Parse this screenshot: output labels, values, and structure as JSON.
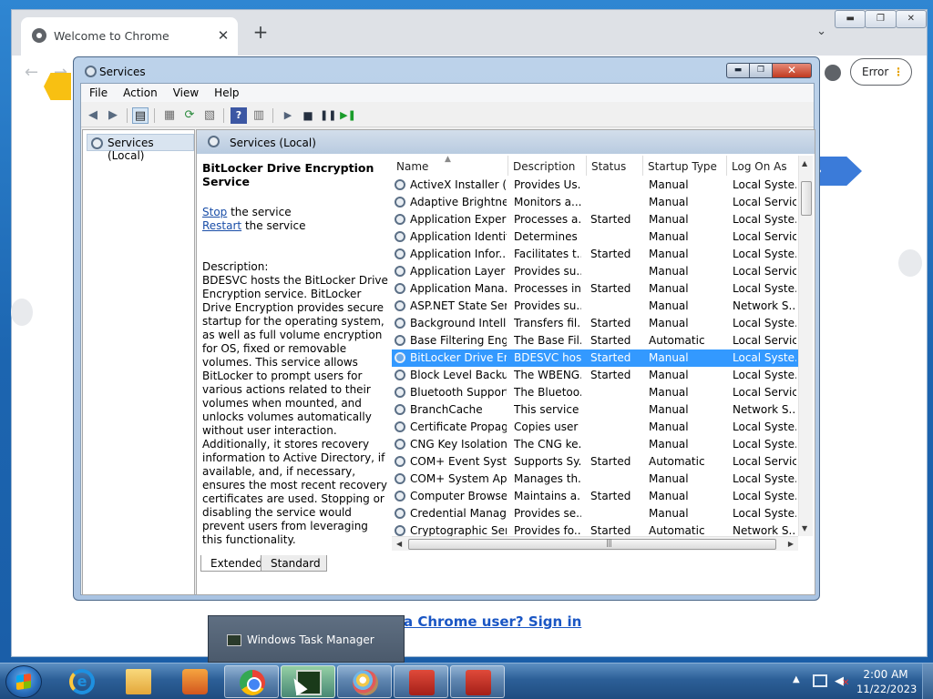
{
  "chrome": {
    "tab_title": "Welcome to Chrome",
    "tab_close": "✕",
    "new_tab": "+",
    "tab_dropdown": "⌄",
    "back": "←",
    "forward": "→",
    "error_label": "Error",
    "error_menu": "⋮",
    "signin_text": "y a Chrome user? Sign in",
    "window_controls": [
      "▬",
      "❐",
      "✕"
    ]
  },
  "services": {
    "window_title": "Services",
    "window_controls": [
      "▬",
      "❐",
      "✕"
    ],
    "menu": [
      "File",
      "Action",
      "View",
      "Help"
    ],
    "tree_item": "Services (Local)",
    "pane_title": "Services (Local)",
    "selected_service": "BitLocker Drive Encryption Service",
    "stop_link": "Stop",
    "stop_suffix": " the service",
    "restart_link": "Restart",
    "restart_suffix": " the service",
    "description_label": "Description:",
    "description": "BDESVC hosts the BitLocker Drive Encryption service. BitLocker Drive Encryption provides secure startup for the operating system, as well as full volume encryption for OS, fixed or removable volumes. This service allows BitLocker to prompt users for various actions related to their volumes when mounted, and unlocks volumes automatically without user interaction. Additionally, it stores recovery information to Active Directory, if available, and, if necessary, ensures the most recent recovery certificates are used. Stopping or disabling the service would prevent users from leveraging this functionality.",
    "columns": [
      "Name",
      "Description",
      "Status",
      "Startup Type",
      "Log On As"
    ],
    "rows": [
      {
        "name": "ActiveX Installer (...",
        "desc": "Provides Us...",
        "status": "",
        "startup": "Manual",
        "logon": "Local Syste..."
      },
      {
        "name": "Adaptive Brightness",
        "desc": "Monitors a...",
        "status": "",
        "startup": "Manual",
        "logon": "Local Service"
      },
      {
        "name": "Application Experi...",
        "desc": "Processes a...",
        "status": "Started",
        "startup": "Manual",
        "logon": "Local Syste..."
      },
      {
        "name": "Application Identity",
        "desc": "Determines ...",
        "status": "",
        "startup": "Manual",
        "logon": "Local Service"
      },
      {
        "name": "Application Infor...",
        "desc": "Facilitates t...",
        "status": "Started",
        "startup": "Manual",
        "logon": "Local Syste..."
      },
      {
        "name": "Application Layer ...",
        "desc": "Provides su...",
        "status": "",
        "startup": "Manual",
        "logon": "Local Service"
      },
      {
        "name": "Application Mana...",
        "desc": "Processes in...",
        "status": "Started",
        "startup": "Manual",
        "logon": "Local Syste..."
      },
      {
        "name": "ASP.NET State Ser...",
        "desc": "Provides su...",
        "status": "",
        "startup": "Manual",
        "logon": "Network S..."
      },
      {
        "name": "Background Intelli...",
        "desc": "Transfers fil...",
        "status": "Started",
        "startup": "Manual",
        "logon": "Local Syste..."
      },
      {
        "name": "Base Filtering Engi...",
        "desc": "The Base Fil...",
        "status": "Started",
        "startup": "Automatic",
        "logon": "Local Service"
      },
      {
        "name": "BitLocker Drive En...",
        "desc": "BDESVC hos...",
        "status": "Started",
        "startup": "Manual",
        "logon": "Local Syste...",
        "selected": true
      },
      {
        "name": "Block Level Backu...",
        "desc": "The WBENG...",
        "status": "Started",
        "startup": "Manual",
        "logon": "Local Syste..."
      },
      {
        "name": "Bluetooth Support...",
        "desc": "The Bluetoo...",
        "status": "",
        "startup": "Manual",
        "logon": "Local Service"
      },
      {
        "name": "BranchCache",
        "desc": "This service ...",
        "status": "",
        "startup": "Manual",
        "logon": "Network S..."
      },
      {
        "name": "Certificate Propag...",
        "desc": "Copies user ...",
        "status": "",
        "startup": "Manual",
        "logon": "Local Syste..."
      },
      {
        "name": "CNG Key Isolation",
        "desc": "The CNG ke...",
        "status": "",
        "startup": "Manual",
        "logon": "Local Syste..."
      },
      {
        "name": "COM+ Event Syst...",
        "desc": "Supports Sy...",
        "status": "Started",
        "startup": "Automatic",
        "logon": "Local Service"
      },
      {
        "name": "COM+ System Ap...",
        "desc": "Manages th...",
        "status": "",
        "startup": "Manual",
        "logon": "Local Syste..."
      },
      {
        "name": "Computer Browser",
        "desc": "Maintains a...",
        "status": "Started",
        "startup": "Manual",
        "logon": "Local Syste..."
      },
      {
        "name": "Credential Manager",
        "desc": "Provides se...",
        "status": "",
        "startup": "Manual",
        "logon": "Local Syste..."
      },
      {
        "name": "Cryptographic Ser...",
        "desc": "Provides fo...",
        "status": "Started",
        "startup": "Automatic",
        "logon": "Network S..."
      }
    ],
    "view_tabs": [
      "Extended",
      "Standard"
    ]
  },
  "taskbar": {
    "task_manager_popup": "Windows Task Manager",
    "clock_time": "2:00 AM",
    "clock_date": "11/22/2023"
  }
}
